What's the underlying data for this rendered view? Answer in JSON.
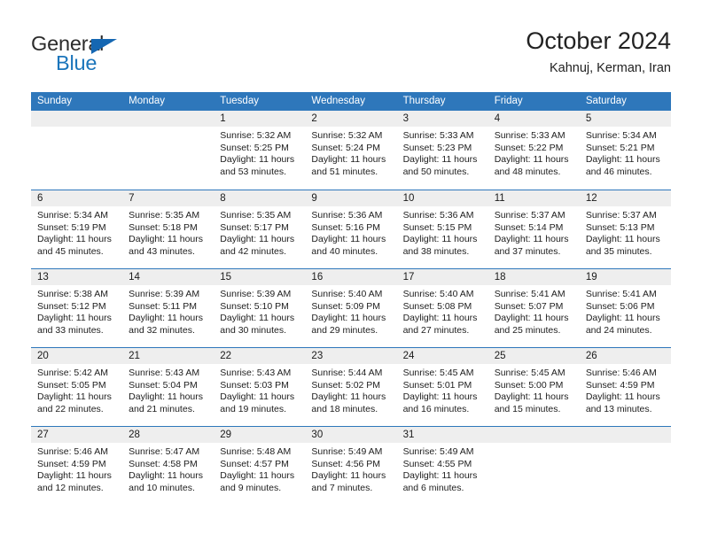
{
  "logo": {
    "text_top": "General",
    "text_bottom": "Blue",
    "triangle_color": "#1567b2",
    "blue_color": "#1b75bb"
  },
  "header": {
    "title": "October 2024",
    "subtitle": "Kahnuj, Kerman, Iran"
  },
  "theme": {
    "header_blue": "#2e77bb",
    "day_strip_gray": "#eeeeee",
    "text_color": "#1a1a1a"
  },
  "weekdays": [
    "Sunday",
    "Monday",
    "Tuesday",
    "Wednesday",
    "Thursday",
    "Friday",
    "Saturday"
  ],
  "labels": {
    "sunrise": "Sunrise:",
    "sunset": "Sunset:",
    "daylight": "Daylight:"
  },
  "weeks": [
    [
      {
        "day": "",
        "empty": true
      },
      {
        "day": "",
        "empty": true
      },
      {
        "day": "1",
        "sunrise": "Sunrise: 5:32 AM",
        "sunset": "Sunset: 5:25 PM",
        "daylight": "Daylight: 11 hours and 53 minutes."
      },
      {
        "day": "2",
        "sunrise": "Sunrise: 5:32 AM",
        "sunset": "Sunset: 5:24 PM",
        "daylight": "Daylight: 11 hours and 51 minutes."
      },
      {
        "day": "3",
        "sunrise": "Sunrise: 5:33 AM",
        "sunset": "Sunset: 5:23 PM",
        "daylight": "Daylight: 11 hours and 50 minutes."
      },
      {
        "day": "4",
        "sunrise": "Sunrise: 5:33 AM",
        "sunset": "Sunset: 5:22 PM",
        "daylight": "Daylight: 11 hours and 48 minutes."
      },
      {
        "day": "5",
        "sunrise": "Sunrise: 5:34 AM",
        "sunset": "Sunset: 5:21 PM",
        "daylight": "Daylight: 11 hours and 46 minutes."
      }
    ],
    [
      {
        "day": "6",
        "sunrise": "Sunrise: 5:34 AM",
        "sunset": "Sunset: 5:19 PM",
        "daylight": "Daylight: 11 hours and 45 minutes."
      },
      {
        "day": "7",
        "sunrise": "Sunrise: 5:35 AM",
        "sunset": "Sunset: 5:18 PM",
        "daylight": "Daylight: 11 hours and 43 minutes."
      },
      {
        "day": "8",
        "sunrise": "Sunrise: 5:35 AM",
        "sunset": "Sunset: 5:17 PM",
        "daylight": "Daylight: 11 hours and 42 minutes."
      },
      {
        "day": "9",
        "sunrise": "Sunrise: 5:36 AM",
        "sunset": "Sunset: 5:16 PM",
        "daylight": "Daylight: 11 hours and 40 minutes."
      },
      {
        "day": "10",
        "sunrise": "Sunrise: 5:36 AM",
        "sunset": "Sunset: 5:15 PM",
        "daylight": "Daylight: 11 hours and 38 minutes."
      },
      {
        "day": "11",
        "sunrise": "Sunrise: 5:37 AM",
        "sunset": "Sunset: 5:14 PM",
        "daylight": "Daylight: 11 hours and 37 minutes."
      },
      {
        "day": "12",
        "sunrise": "Sunrise: 5:37 AM",
        "sunset": "Sunset: 5:13 PM",
        "daylight": "Daylight: 11 hours and 35 minutes."
      }
    ],
    [
      {
        "day": "13",
        "sunrise": "Sunrise: 5:38 AM",
        "sunset": "Sunset: 5:12 PM",
        "daylight": "Daylight: 11 hours and 33 minutes."
      },
      {
        "day": "14",
        "sunrise": "Sunrise: 5:39 AM",
        "sunset": "Sunset: 5:11 PM",
        "daylight": "Daylight: 11 hours and 32 minutes."
      },
      {
        "day": "15",
        "sunrise": "Sunrise: 5:39 AM",
        "sunset": "Sunset: 5:10 PM",
        "daylight": "Daylight: 11 hours and 30 minutes."
      },
      {
        "day": "16",
        "sunrise": "Sunrise: 5:40 AM",
        "sunset": "Sunset: 5:09 PM",
        "daylight": "Daylight: 11 hours and 29 minutes."
      },
      {
        "day": "17",
        "sunrise": "Sunrise: 5:40 AM",
        "sunset": "Sunset: 5:08 PM",
        "daylight": "Daylight: 11 hours and 27 minutes."
      },
      {
        "day": "18",
        "sunrise": "Sunrise: 5:41 AM",
        "sunset": "Sunset: 5:07 PM",
        "daylight": "Daylight: 11 hours and 25 minutes."
      },
      {
        "day": "19",
        "sunrise": "Sunrise: 5:41 AM",
        "sunset": "Sunset: 5:06 PM",
        "daylight": "Daylight: 11 hours and 24 minutes."
      }
    ],
    [
      {
        "day": "20",
        "sunrise": "Sunrise: 5:42 AM",
        "sunset": "Sunset: 5:05 PM",
        "daylight": "Daylight: 11 hours and 22 minutes."
      },
      {
        "day": "21",
        "sunrise": "Sunrise: 5:43 AM",
        "sunset": "Sunset: 5:04 PM",
        "daylight": "Daylight: 11 hours and 21 minutes."
      },
      {
        "day": "22",
        "sunrise": "Sunrise: 5:43 AM",
        "sunset": "Sunset: 5:03 PM",
        "daylight": "Daylight: 11 hours and 19 minutes."
      },
      {
        "day": "23",
        "sunrise": "Sunrise: 5:44 AM",
        "sunset": "Sunset: 5:02 PM",
        "daylight": "Daylight: 11 hours and 18 minutes."
      },
      {
        "day": "24",
        "sunrise": "Sunrise: 5:45 AM",
        "sunset": "Sunset: 5:01 PM",
        "daylight": "Daylight: 11 hours and 16 minutes."
      },
      {
        "day": "25",
        "sunrise": "Sunrise: 5:45 AM",
        "sunset": "Sunset: 5:00 PM",
        "daylight": "Daylight: 11 hours and 15 minutes."
      },
      {
        "day": "26",
        "sunrise": "Sunrise: 5:46 AM",
        "sunset": "Sunset: 4:59 PM",
        "daylight": "Daylight: 11 hours and 13 minutes."
      }
    ],
    [
      {
        "day": "27",
        "sunrise": "Sunrise: 5:46 AM",
        "sunset": "Sunset: 4:59 PM",
        "daylight": "Daylight: 11 hours and 12 minutes."
      },
      {
        "day": "28",
        "sunrise": "Sunrise: 5:47 AM",
        "sunset": "Sunset: 4:58 PM",
        "daylight": "Daylight: 11 hours and 10 minutes."
      },
      {
        "day": "29",
        "sunrise": "Sunrise: 5:48 AM",
        "sunset": "Sunset: 4:57 PM",
        "daylight": "Daylight: 11 hours and 9 minutes."
      },
      {
        "day": "30",
        "sunrise": "Sunrise: 5:49 AM",
        "sunset": "Sunset: 4:56 PM",
        "daylight": "Daylight: 11 hours and 7 minutes."
      },
      {
        "day": "31",
        "sunrise": "Sunrise: 5:49 AM",
        "sunset": "Sunset: 4:55 PM",
        "daylight": "Daylight: 11 hours and 6 minutes."
      },
      {
        "day": "",
        "empty": true
      },
      {
        "day": "",
        "empty": true
      }
    ]
  ]
}
